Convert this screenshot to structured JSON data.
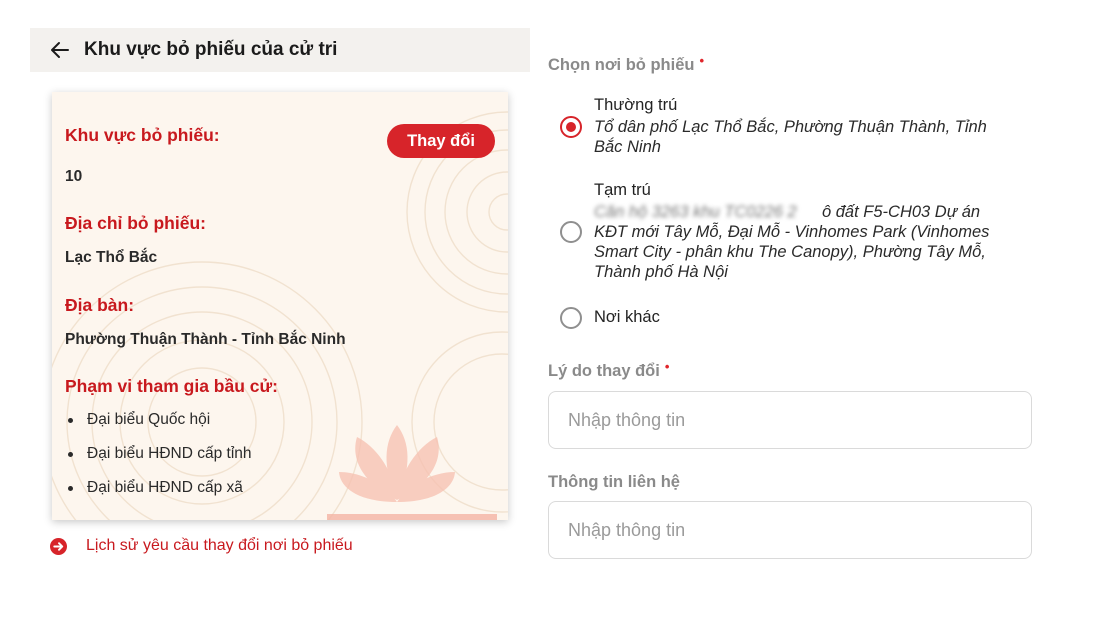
{
  "header": {
    "title": "Khu vực bỏ phiếu của cử tri",
    "back_icon": "arrow-left-icon"
  },
  "card": {
    "change_button_label": "Thay đổi",
    "sections": [
      {
        "label": "Khu vực bỏ phiếu:",
        "value": "10"
      },
      {
        "label": "Địa chỉ bỏ phiếu:",
        "value": "Lạc Thổ Bắc"
      },
      {
        "label": "Địa bàn:",
        "value": "Phường Thuận Thành - Tỉnh Bắc Ninh"
      }
    ],
    "scope": {
      "label": "Phạm vi tham gia bầu cử:",
      "items": [
        "Đại biểu Quốc hội",
        "Đại biểu HĐND cấp tỉnh",
        "Đại biểu HĐND cấp xã"
      ]
    }
  },
  "history_link": {
    "label": "Lịch sử yêu cầu thay đổi nơi bỏ phiếu",
    "icon": "arrow-right-circle-icon"
  },
  "form": {
    "voting_place": {
      "label": "Chọn nơi bỏ phiếu",
      "required_mark": "•",
      "options": [
        {
          "title": "Thường trú",
          "desc_lines": [
            "Tổ dân phố Lạc Thổ Bắc, Phường Thuận Thành, Tỉnh",
            "Bắc Ninh"
          ],
          "checked": true
        },
        {
          "title": "Tạm trú",
          "desc_hidden_part": "Căn hộ 3263 khu TC0226 2",
          "desc_lines": [
            "ô đất F5-CH03 Dự án",
            "KĐT mới Tây Mỗ, Đại Mỗ - Vinhomes Park (Vinhomes",
            "Smart City - phân khu The Canopy), Phường Tây Mỗ,",
            "Thành phố Hà Nội"
          ],
          "checked": false
        },
        {
          "title": "Nơi khác",
          "checked": false
        }
      ]
    },
    "reason": {
      "label": "Lý do thay đổi",
      "required_mark": "•",
      "placeholder": "Nhập thông tin",
      "value": ""
    },
    "contact": {
      "label": "Thông tin liên hệ",
      "placeholder": "Nhập thông tin",
      "value": ""
    }
  },
  "colors": {
    "accent_red": "#d7242a",
    "label_red": "#c8191e",
    "card_bg": "#fdf6ee",
    "header_bg": "#f3f1ee"
  }
}
